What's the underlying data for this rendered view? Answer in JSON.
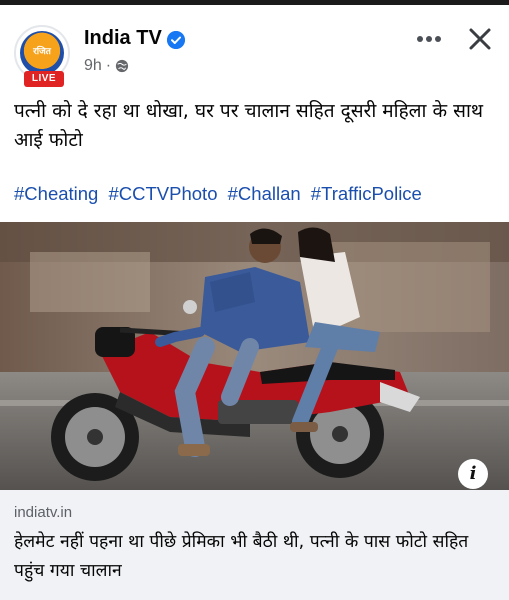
{
  "post": {
    "page_name": "India TV",
    "time": "9h",
    "separator": "·",
    "live_label": "LIVE",
    "avatar_text": "रजित",
    "text": "पत्नी को दे रहा था धोखा, घर पर चालान सहित दूसरी महिला के साथ आई फोटो",
    "hashtags": [
      "#Cheating",
      "#CCTVPhoto",
      "#Challan",
      "#TrafficPolice"
    ]
  },
  "actions": {
    "more_icon": "more-options-icon",
    "close_icon": "close-icon"
  },
  "photo": {
    "info_label": "i",
    "description": "Couple riding a red motorcycle without helmets"
  },
  "link": {
    "domain": "indiatv.in",
    "title": "हेलमेट नहीं पहना था पीछे प्रेमिका भी बैठी थी, पत्नी के पास फोटो सहित पहुंच गया चालान"
  },
  "colors": {
    "hashtag": "#1b4fae",
    "verified": "#1877f2",
    "live": "#e02424",
    "link_card_bg": "#f0f2f5"
  }
}
